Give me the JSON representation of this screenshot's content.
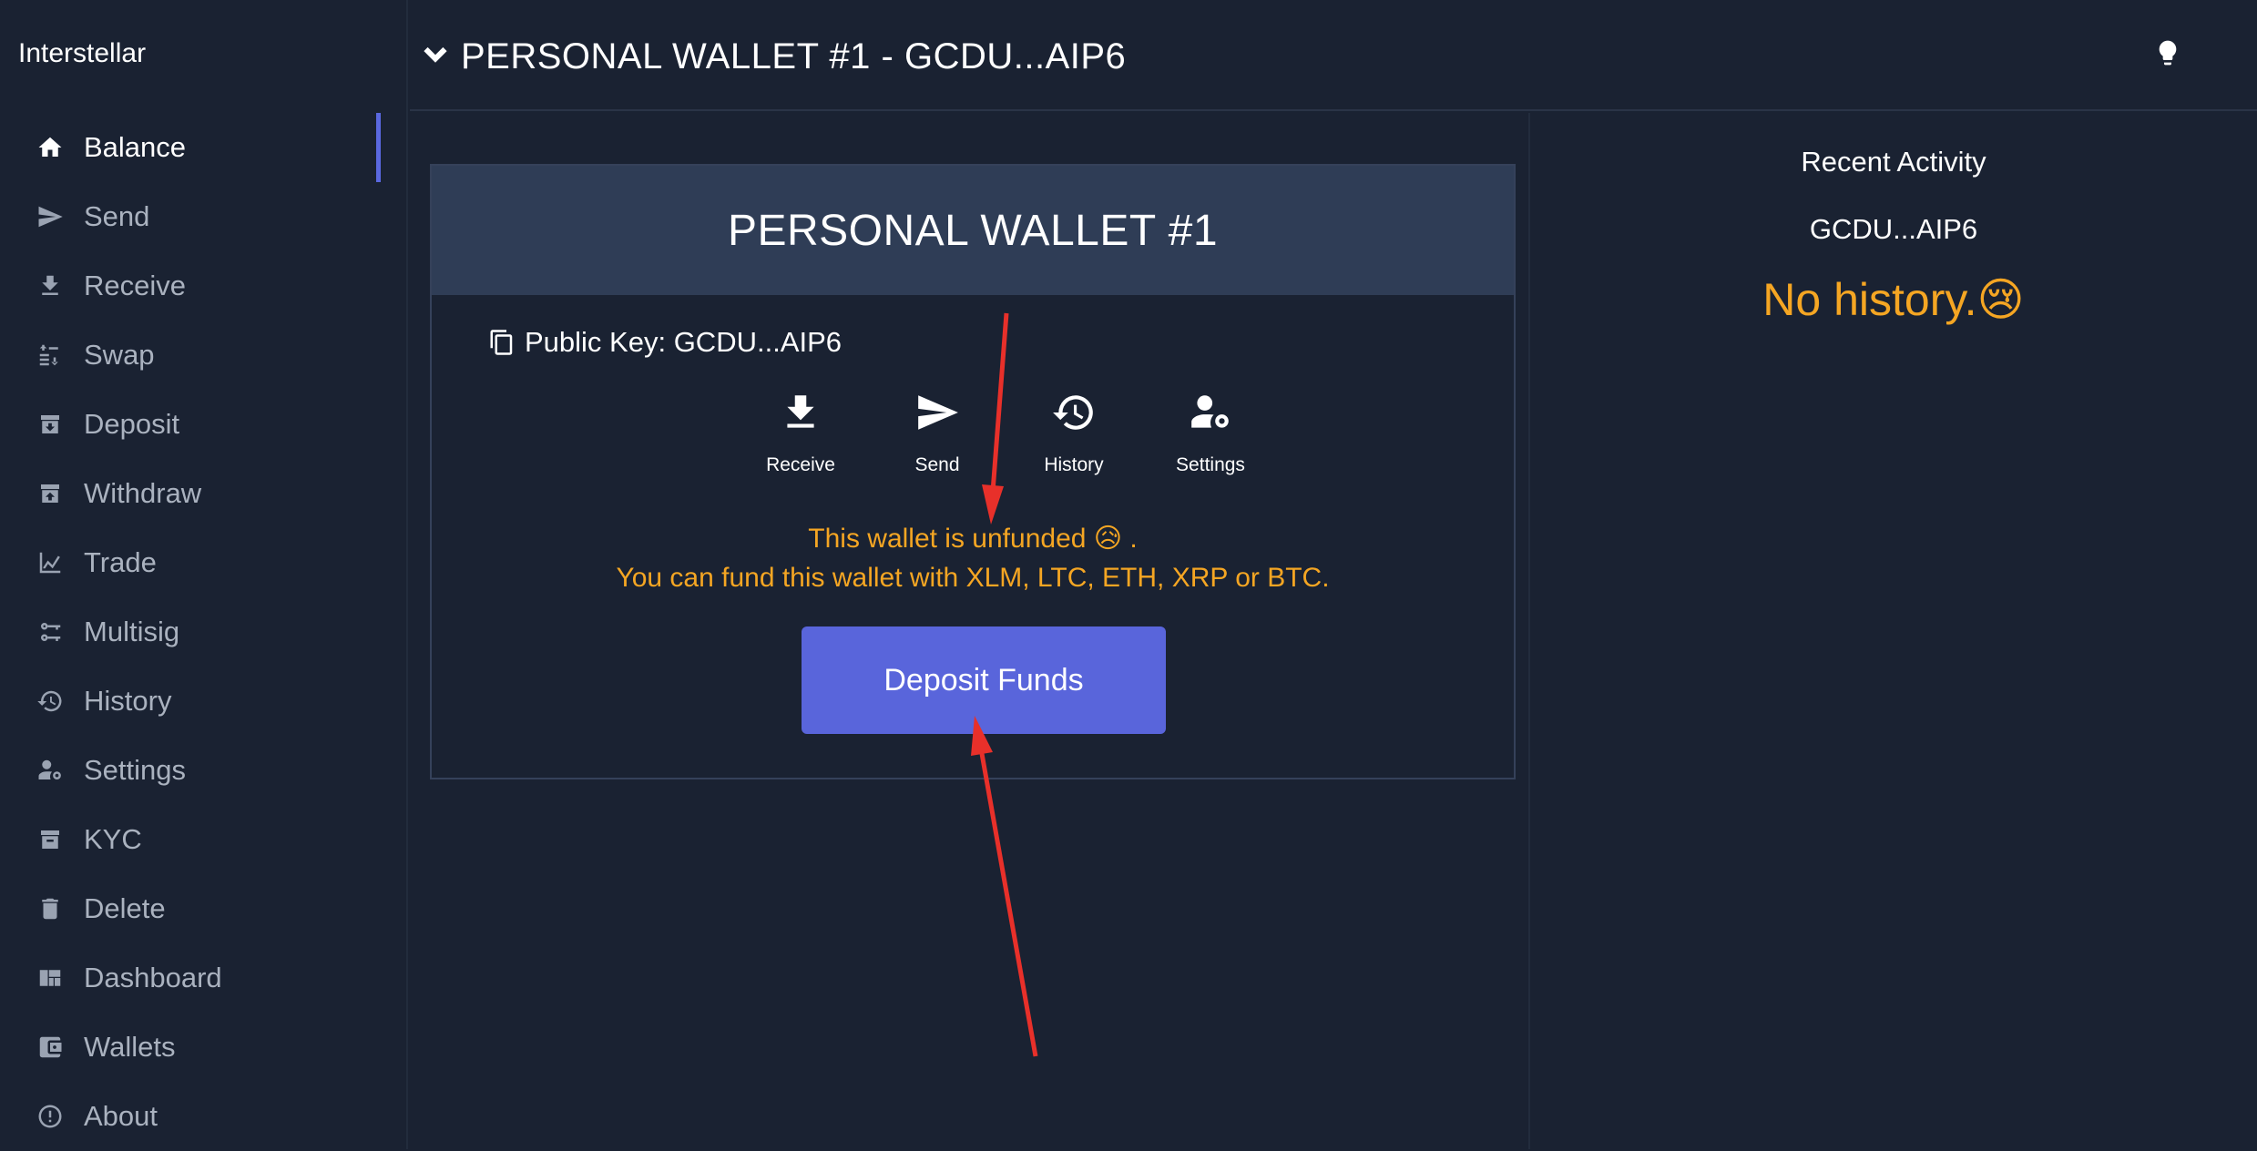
{
  "app": {
    "title": "Interstellar"
  },
  "sidebar": {
    "items": [
      {
        "label": "Balance",
        "icon": "home-icon"
      },
      {
        "label": "Send",
        "icon": "send-icon"
      },
      {
        "label": "Receive",
        "icon": "download-icon"
      },
      {
        "label": "Swap",
        "icon": "swap-icon"
      },
      {
        "label": "Deposit",
        "icon": "archive-icon"
      },
      {
        "label": "Withdraw",
        "icon": "unarchive-icon"
      },
      {
        "label": "Trade",
        "icon": "chart-icon"
      },
      {
        "label": "Multisig",
        "icon": "key-icon"
      },
      {
        "label": "History",
        "icon": "history-icon"
      },
      {
        "label": "Settings",
        "icon": "user-settings-icon"
      },
      {
        "label": "KYC",
        "icon": "id-box-icon"
      },
      {
        "label": "Delete",
        "icon": "trash-icon"
      },
      {
        "label": "Dashboard",
        "icon": "dashboard-icon"
      },
      {
        "label": "Wallets",
        "icon": "wallet-icon"
      },
      {
        "label": "About",
        "icon": "info-icon"
      }
    ],
    "active": "Balance"
  },
  "header": {
    "title": "PERSONAL WALLET #1 - GCDU...AIP6"
  },
  "wallet": {
    "name": "PERSONAL WALLET #1",
    "public_key": "Public Key: GCDU...AIP6",
    "actions": [
      {
        "label": "Receive",
        "icon": "download-icon"
      },
      {
        "label": "Send",
        "icon": "send-icon"
      },
      {
        "label": "History",
        "icon": "history-icon"
      },
      {
        "label": "Settings",
        "icon": "user-settings-icon"
      }
    ],
    "message_line1": "This wallet is unfunded 😥 .",
    "message_line2": "You can fund this wallet with XLM, LTC, ETH, XRP or BTC.",
    "deposit_button": "Deposit Funds"
  },
  "recent_activity": {
    "title": "Recent Activity",
    "key": "GCDU...AIP6",
    "empty": "No history.😢"
  },
  "colors": {
    "background": "#1a2232",
    "card_header": "#2f3d56",
    "accent": "#5965db",
    "warning": "#f5a623",
    "annotation": "#e8302a"
  }
}
